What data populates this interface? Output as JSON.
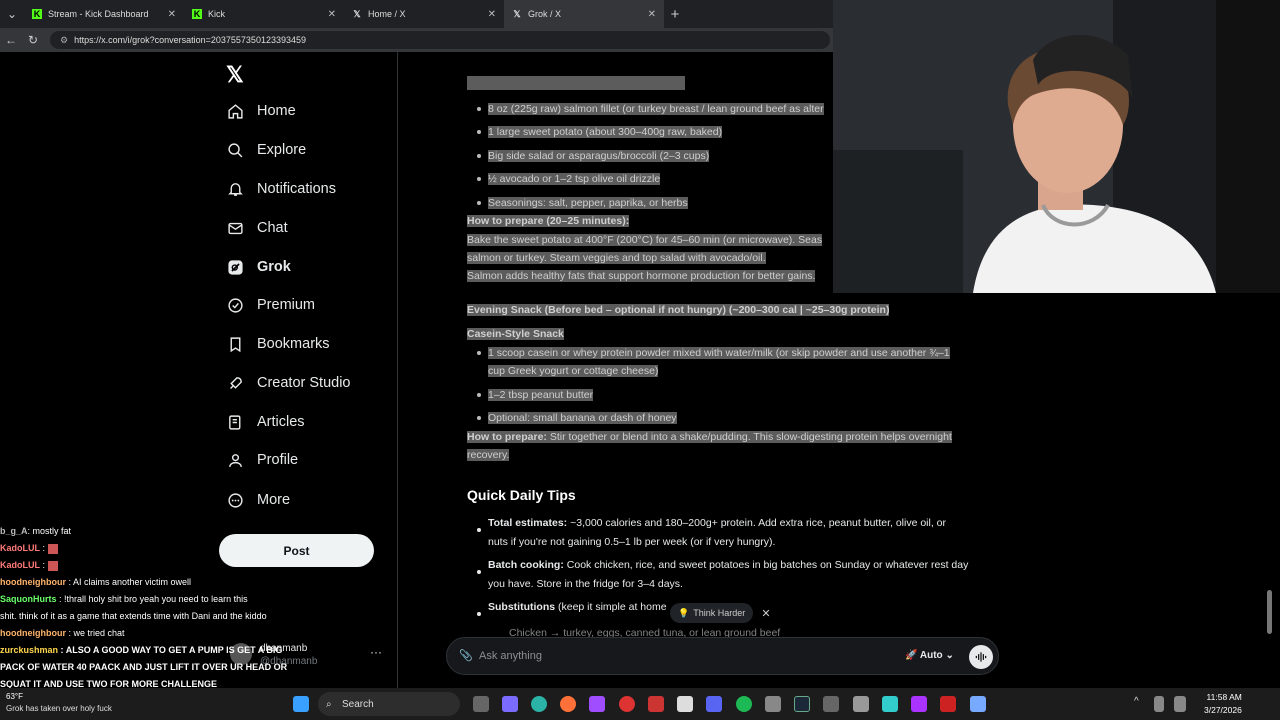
{
  "browser": {
    "tabs": [
      {
        "label": "Stream - Kick Dashboard",
        "icon": "kick-icon"
      },
      {
        "label": "Kick",
        "icon": "kick-icon"
      },
      {
        "label": "Home / X",
        "icon": "x-icon"
      },
      {
        "label": "Grok / X",
        "icon": "x-icon",
        "active": true
      }
    ],
    "url": "https://x.com/i/grok?conversation=2037557350123393459"
  },
  "sidebar": {
    "items": [
      {
        "label": "Home",
        "icon": "home-icon"
      },
      {
        "label": "Explore",
        "icon": "search-icon"
      },
      {
        "label": "Notifications",
        "icon": "bell-icon"
      },
      {
        "label": "Chat",
        "icon": "mail-icon"
      },
      {
        "label": "Grok",
        "icon": "grok-icon",
        "active": true
      },
      {
        "label": "Premium",
        "icon": "verified-icon"
      },
      {
        "label": "Bookmarks",
        "icon": "bookmark-icon"
      },
      {
        "label": "Creator Studio",
        "icon": "rocket-icon"
      },
      {
        "label": "Articles",
        "icon": "article-icon"
      },
      {
        "label": "Profile",
        "icon": "person-icon"
      },
      {
        "label": "More",
        "icon": "more-circle-icon"
      }
    ],
    "post_label": "Post",
    "profile": {
      "name": "dhanmanb",
      "handle": "@dhanmanb"
    }
  },
  "content": {
    "list1": [
      "8 oz (225g raw) salmon fillet (or turkey breast / lean ground beef as alter",
      "1 large sweet potato (about 300–400g raw, baked)",
      "Big side salad or asparagus/broccoli (2–3 cups)",
      "½ avocado or 1–2 tsp olive oil drizzle",
      "Seasonings: salt, pepper, paprika, or herbs"
    ],
    "prep1_label": "How to prepare (20–25 minutes):",
    "prep1_lines": [
      "Bake the sweet potato at 400°F (200°C) for 45–60 min (or microwave). Seas",
      "salmon or turkey. Steam veggies and top salad with avocado/oil.",
      "Salmon adds healthy fats that support hormone production for better gains."
    ],
    "snack_heading": "Evening Snack (Before bed – optional if not hungry) (~200–300 cal | ~25–30g protein)",
    "snack_title": "Casein-Style Snack",
    "list2": [
      [
        "1 scoop casein or whey protein powder mixed with water/milk (or skip powder and use another ¾–1",
        "cup Greek yogurt or cottage cheese)"
      ],
      [
        "1–2 tbsp peanut butter"
      ],
      [
        "Optional: small banana or dash of honey"
      ]
    ],
    "prep2_label": "How to prepare:",
    "prep2_line1": "Stir together or blend into a shake/pudding. This slow-digesting protein helps overnight",
    "prep2_line2": "recovery.",
    "tips_heading": "Quick Daily Tips",
    "tips": [
      {
        "label": "Total estimates:",
        "line1": "~3,000 calories and 180–200g+ protein. Add extra rice, peanut butter, olive oil, or",
        "line2": "nuts if you're not gaining 0.5–1 lb per week (or if very hungry)."
      },
      {
        "label": "Batch cooking:",
        "line1": "Cook chicken, rice, and sweet potatoes in big batches on Sunday or whatever rest day",
        "line2": "you have. Store in the fridge for 3–4 days."
      },
      {
        "label": "Substitutions",
        "line1": "(keep it simple at home",
        "line2": ""
      }
    ],
    "sub_item": "Chicken → turkey, eggs, canned tuna, or lean ground beef",
    "think_harder": "Think Harder",
    "ask_placeholder": "Ask anything",
    "mode": "Auto"
  },
  "chat": [
    {
      "user": "b_g_A",
      "msg": ": mostly fat",
      "color": "#bbbbbb"
    },
    {
      "user": "KadoLUL",
      "msg": ":",
      "color": "#ff7a7a"
    },
    {
      "user": "KadoLUL",
      "msg": ":",
      "color": "#ff7a7a"
    },
    {
      "user": "hoodneighbour",
      "msg": ": AI claims another victim owell",
      "color": "#ffb36b"
    },
    {
      "user": "SaquonHurts",
      "msg": ": !thrall holy shit bro yeah you need to learn this",
      "color": "#6bff6b"
    },
    {
      "user": "",
      "msg": "shit. think of it as a game that extends time with Dani and the kiddo",
      "color": "#ffffff"
    },
    {
      "user": "hoodneighbour",
      "msg": ": we tried chat",
      "color": "#ffb36b"
    },
    {
      "user": "zurckushman",
      "msg": ": ALSO A GOOD WAY TO GET A PUMP IS GET A BIG",
      "color": "#ffd84d"
    },
    {
      "user": "",
      "msg": "PACK OF WATER 40 PAACK AND JUST LIFT IT OVER UR HEAD OR",
      "color": "#ffffff"
    },
    {
      "user": "",
      "msg": "SQUAT IT AND USE TWO FOR MORE CHALLENGE",
      "color": "#ffffff"
    },
    {
      "user": "",
      "msg": "Grok has taken over holy fuck",
      "color": "#ffffff"
    }
  ],
  "taskbar": {
    "search": "Search",
    "time": "11:58 AM",
    "date": "3/27/2026",
    "weather_temp": "63°F"
  }
}
